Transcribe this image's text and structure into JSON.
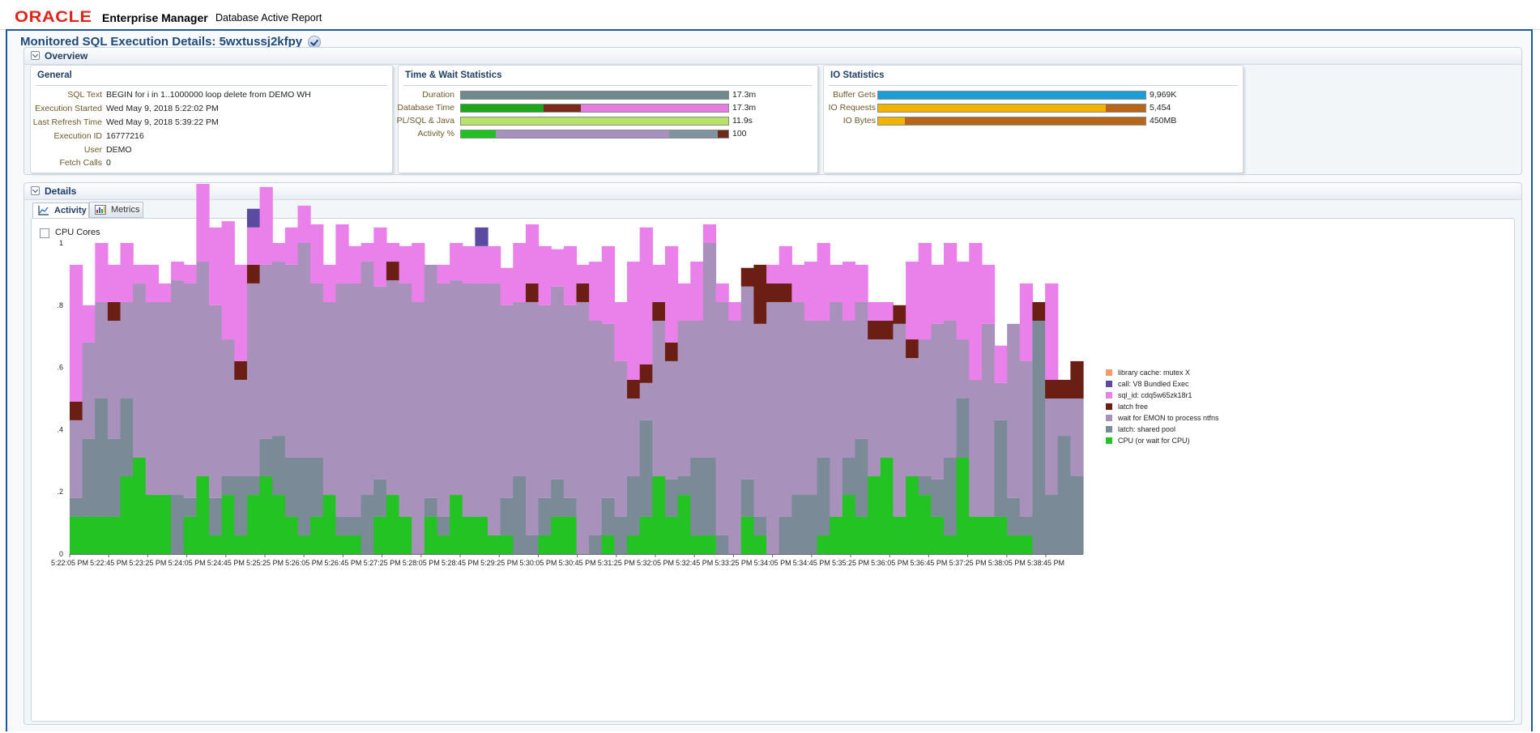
{
  "header": {
    "logo": "ORACLE",
    "product": "Enterprise Manager",
    "report": "Database Active Report"
  },
  "page": {
    "title": "Monitored SQL Execution Details: 5wxtussj2kfpy"
  },
  "overview": {
    "title": "Overview",
    "general": {
      "title": "General",
      "rows": [
        {
          "label": "SQL Text",
          "value": "BEGIN for i in 1..1000000 loop delete from DEMO WH"
        },
        {
          "label": "Execution Started",
          "value": "Wed May 9, 2018 5:22:02 PM"
        },
        {
          "label": "Last Refresh Time",
          "value": "Wed May 9, 2018 5:39:22 PM"
        },
        {
          "label": "Execution ID",
          "value": "16777216"
        },
        {
          "label": "User",
          "value": "DEMO"
        },
        {
          "label": "Fetch Calls",
          "value": "0"
        }
      ],
      "ellipsis": "..."
    },
    "time_wait": {
      "title": "Time & Wait Statistics",
      "rows": [
        {
          "label": "Duration",
          "value": "17.3m",
          "segments": [
            {
              "color": "#6e8a8a",
              "frac": 1.0
            }
          ]
        },
        {
          "label": "Database Time",
          "value": "17.3m",
          "segments": [
            {
              "color": "#1aa81a",
              "frac": 0.31
            },
            {
              "color": "#7a2a1a",
              "frac": 0.14
            },
            {
              "color": "#e57de0",
              "frac": 0.55
            }
          ]
        },
        {
          "label": "PL/SQL & Java",
          "value": "11.9s",
          "segments": [
            {
              "color": "#b6e36a",
              "frac": 1.0
            }
          ]
        },
        {
          "label": "Activity %",
          "value": "100",
          "segments": [
            {
              "color": "#1fc21f",
              "frac": 0.13
            },
            {
              "color": "#a890c0",
              "frac": 0.65
            },
            {
              "color": "#8094a0",
              "frac": 0.18
            },
            {
              "color": "#6b2a1a",
              "frac": 0.04
            }
          ]
        }
      ]
    },
    "io": {
      "title": "IO Statistics",
      "rows": [
        {
          "label": "Buffer Gets",
          "value": "9,969K",
          "segments": [
            {
              "color": "#1a9ed8",
              "frac": 1.0
            }
          ]
        },
        {
          "label": "IO Requests",
          "value": "5,454",
          "segments": [
            {
              "color": "#f0b400",
              "frac": 0.85
            },
            {
              "color": "#b8671a",
              "frac": 0.15
            }
          ]
        },
        {
          "label": "IO Bytes",
          "value": "450MB",
          "segments": [
            {
              "color": "#f0b400",
              "frac": 0.1
            },
            {
              "color": "#b8671a",
              "frac": 0.9
            }
          ]
        }
      ]
    }
  },
  "details": {
    "title": "Details",
    "tabs": [
      {
        "label": "Activity",
        "active": true
      },
      {
        "label": "Metrics",
        "active": false
      }
    ],
    "cpu_cores_label": "CPU Cores"
  },
  "chart_data": {
    "type": "area",
    "title": "",
    "xlabel": "",
    "ylabel": "",
    "ylim": [
      0,
      1
    ],
    "y_ticks": [
      "0",
      ".2",
      ".4",
      ".6",
      ".8",
      "1"
    ],
    "x_ticks": [
      "5:22:05 PM",
      "5:22:45 PM",
      "5:23:25 PM",
      "5:24:05 PM",
      "5:24:45 PM",
      "5:25:25 PM",
      "5:26:05 PM",
      "5:26:45 PM",
      "5:27:25 PM",
      "5:28:05 PM",
      "5:28:45 PM",
      "5:29:25 PM",
      "5:30:05 PM",
      "5:30:45 PM",
      "5:31:25 PM",
      "5:32:05 PM",
      "5:32:45 PM",
      "5:33:25 PM",
      "5:34:05 PM",
      "5:34:45 PM",
      "5:35:25 PM",
      "5:36:05 PM",
      "5:36:45 PM",
      "5:37:25 PM",
      "5:38:05 PM",
      "5:38:45 PM"
    ],
    "legend_position": "right",
    "series": [
      {
        "name": "CPU (or wait for CPU)",
        "color": "#22c322",
        "values": [
          0.12,
          0.12,
          0.12,
          0.12,
          0.25,
          0.31,
          0.19,
          0.19,
          0.0,
          0.12,
          0.25,
          0.06,
          0.19,
          0.06,
          0.19,
          0.25,
          0.19,
          0.12,
          0.06,
          0.12,
          0.19,
          0.06,
          0.06,
          0.0,
          0.12,
          0.19,
          0.12,
          0.0,
          0.12,
          0.06,
          0.19,
          0.12,
          0.12,
          0.06,
          0.06,
          0.0,
          0.0,
          0.06,
          0.12,
          0.12,
          0.0,
          0.0,
          0.06,
          0.0,
          0.06,
          0.12,
          0.25,
          0.12,
          0.19,
          0.06,
          0.06,
          0.0,
          0.0,
          0.12,
          0.06,
          0.0,
          0.0,
          0.0,
          0.0,
          0.06,
          0.12,
          0.19,
          0.12,
          0.25,
          0.31,
          0.12,
          0.25,
          0.19,
          0.12,
          0.06,
          0.31,
          0.12,
          0.12,
          0.12,
          0.06,
          0.06,
          0.0,
          0.0,
          0.0,
          0.0
        ]
      },
      {
        "name": "latch: shared pool",
        "color": "#7a8a96",
        "values": [
          0.06,
          0.25,
          0.38,
          0.25,
          0.25,
          0.0,
          0.0,
          0.0,
          0.19,
          0.06,
          0.0,
          0.12,
          0.06,
          0.19,
          0.06,
          0.12,
          0.19,
          0.19,
          0.25,
          0.19,
          0.0,
          0.06,
          0.06,
          0.19,
          0.12,
          0.0,
          0.0,
          0.0,
          0.06,
          0.06,
          0.0,
          0.0,
          0.0,
          0.0,
          0.12,
          0.25,
          0.06,
          0.12,
          0.12,
          0.06,
          0.0,
          0.06,
          0.12,
          0.12,
          0.19,
          0.31,
          0.0,
          0.12,
          0.06,
          0.25,
          0.25,
          0.06,
          0.0,
          0.12,
          0.06,
          0.0,
          0.12,
          0.19,
          0.19,
          0.25,
          0.0,
          0.12,
          0.25,
          0.0,
          0.0,
          0.0,
          0.0,
          0.06,
          0.12,
          0.25,
          0.19,
          0.0,
          0.0,
          0.31,
          0.12,
          0.06,
          0.75,
          0.19,
          0.38,
          0.25
        ]
      },
      {
        "name": "wait for EMON to process ntfns",
        "color": "#a892bc",
        "values": [
          0.25,
          0.31,
          0.31,
          0.38,
          0.31,
          0.56,
          0.62,
          0.62,
          0.69,
          0.69,
          0.69,
          0.62,
          0.44,
          0.31,
          0.62,
          0.56,
          0.56,
          0.62,
          0.69,
          0.56,
          0.62,
          0.75,
          0.75,
          0.75,
          0.62,
          0.69,
          0.75,
          0.81,
          0.75,
          0.75,
          0.69,
          0.75,
          0.75,
          0.81,
          0.62,
          0.56,
          0.75,
          0.62,
          0.62,
          0.62,
          0.81,
          0.69,
          0.56,
          0.5,
          0.25,
          0.12,
          0.5,
          0.38,
          0.5,
          0.44,
          0.69,
          0.75,
          0.75,
          0.62,
          0.62,
          0.81,
          0.69,
          0.62,
          0.56,
          0.44,
          0.69,
          0.44,
          0.44,
          0.44,
          0.38,
          0.62,
          0.38,
          0.44,
          0.5,
          0.44,
          0.19,
          0.44,
          0.62,
          0.12,
          0.56,
          0.5,
          0.0,
          0.31,
          0.12,
          0.25
        ]
      },
      {
        "name": "latch free",
        "color": "#6b1f14",
        "values": [
          0.06,
          0.0,
          0.0,
          0.06,
          0.0,
          0.0,
          0.0,
          0.0,
          0.0,
          0.0,
          0.0,
          0.0,
          0.0,
          0.06,
          0.06,
          0.0,
          0.0,
          0.0,
          0.0,
          0.0,
          0.0,
          0.0,
          0.0,
          0.0,
          0.0,
          0.06,
          0.0,
          0.0,
          0.0,
          0.0,
          0.0,
          0.0,
          0.0,
          0.0,
          0.0,
          0.0,
          0.06,
          0.0,
          0.0,
          0.0,
          0.06,
          0.0,
          0.0,
          0.0,
          0.06,
          0.06,
          0.06,
          0.06,
          0.0,
          0.0,
          0.0,
          0.0,
          0.0,
          0.06,
          0.19,
          0.06,
          0.06,
          0.0,
          0.0,
          0.0,
          0.0,
          0.0,
          0.0,
          0.06,
          0.06,
          0.06,
          0.06,
          0.0,
          0.0,
          0.0,
          0.0,
          0.0,
          0.0,
          0.0,
          0.0,
          0.0,
          0.06,
          0.06,
          0.06,
          0.12
        ]
      },
      {
        "name": "sql_id: cdq5w65zk18r1",
        "color": "#ea80ea",
        "values": [
          0.44,
          0.12,
          0.19,
          0.12,
          0.19,
          0.06,
          0.12,
          0.06,
          0.06,
          0.06,
          0.25,
          0.25,
          0.38,
          0.31,
          0.12,
          0.25,
          0.06,
          0.12,
          0.12,
          0.19,
          0.12,
          0.19,
          0.12,
          0.06,
          0.19,
          0.06,
          0.12,
          0.19,
          0.0,
          0.06,
          0.12,
          0.12,
          0.12,
          0.12,
          0.12,
          0.19,
          0.19,
          0.19,
          0.12,
          0.19,
          0.06,
          0.19,
          0.25,
          0.19,
          0.38,
          0.44,
          0.12,
          0.31,
          0.12,
          0.19,
          0.06,
          0.06,
          0.06,
          0.0,
          0.0,
          0.06,
          0.12,
          0.12,
          0.19,
          0.25,
          0.12,
          0.19,
          0.12,
          0.06,
          0.06,
          0.0,
          0.25,
          0.31,
          0.19,
          0.25,
          0.25,
          0.44,
          0.19,
          0.12,
          0.0,
          0.25,
          0.0,
          0.31,
          0.0,
          0.0
        ]
      },
      {
        "name": "call: V8 Bundled Exec",
        "color": "#5a4aa0",
        "values": [
          0.0,
          0.0,
          0.0,
          0.0,
          0.0,
          0.0,
          0.0,
          0.0,
          0.0,
          0.0,
          0.0,
          0.0,
          0.0,
          0.0,
          0.06,
          0.0,
          0.0,
          0.0,
          0.0,
          0.0,
          0.0,
          0.0,
          0.0,
          0.0,
          0.0,
          0.0,
          0.0,
          0.0,
          0.0,
          0.0,
          0.0,
          0.0,
          0.06,
          0.0,
          0.0,
          0.0,
          0.0,
          0.0,
          0.0,
          0.0,
          0.0,
          0.0,
          0.0,
          0.0,
          0.0,
          0.0,
          0.0,
          0.0,
          0.0,
          0.0,
          0.0,
          0.0,
          0.0,
          0.0,
          0.0,
          0.0,
          0.0,
          0.0,
          0.0,
          0.0,
          0.0,
          0.0,
          0.0,
          0.0,
          0.0,
          0.0,
          0.0,
          0.0,
          0.0,
          0.0,
          0.0,
          0.0,
          0.0,
          0.0,
          0.0,
          0.0,
          0.0,
          0.0,
          0.0,
          0.0
        ]
      },
      {
        "name": "library cache: mutex X",
        "color": "#f59a6a",
        "values": [
          0.0,
          0.0,
          0.0,
          0.0,
          0.0,
          0.0,
          0.0,
          0.0,
          0.0,
          0.0,
          0.0,
          0.0,
          0.0,
          0.0,
          0.0,
          0.0,
          0.0,
          0.0,
          0.0,
          0.0,
          0.0,
          0.0,
          0.0,
          0.0,
          0.0,
          0.0,
          0.0,
          0.0,
          0.0,
          0.0,
          0.0,
          0.0,
          0.0,
          0.0,
          0.0,
          0.0,
          0.0,
          0.0,
          0.0,
          0.0,
          0.0,
          0.0,
          0.0,
          0.0,
          0.0,
          0.0,
          0.0,
          0.0,
          0.0,
          0.0,
          0.0,
          0.0,
          0.0,
          0.0,
          0.0,
          0.0,
          0.0,
          0.0,
          0.0,
          0.0,
          0.0,
          0.0,
          0.0,
          0.0,
          0.0,
          0.0,
          0.0,
          0.0,
          0.0,
          0.0,
          0.0,
          0.0,
          0.0,
          0.0,
          0.0,
          0.0,
          0.0,
          0.0,
          0.0,
          0.0
        ]
      }
    ],
    "legend_order": [
      "library cache: mutex X",
      "call: V8 Bundled Exec",
      "sql_id: cdq5w65zk18r1",
      "latch free",
      "wait for EMON to process ntfns",
      "latch: shared pool",
      "CPU (or wait for CPU)"
    ]
  }
}
